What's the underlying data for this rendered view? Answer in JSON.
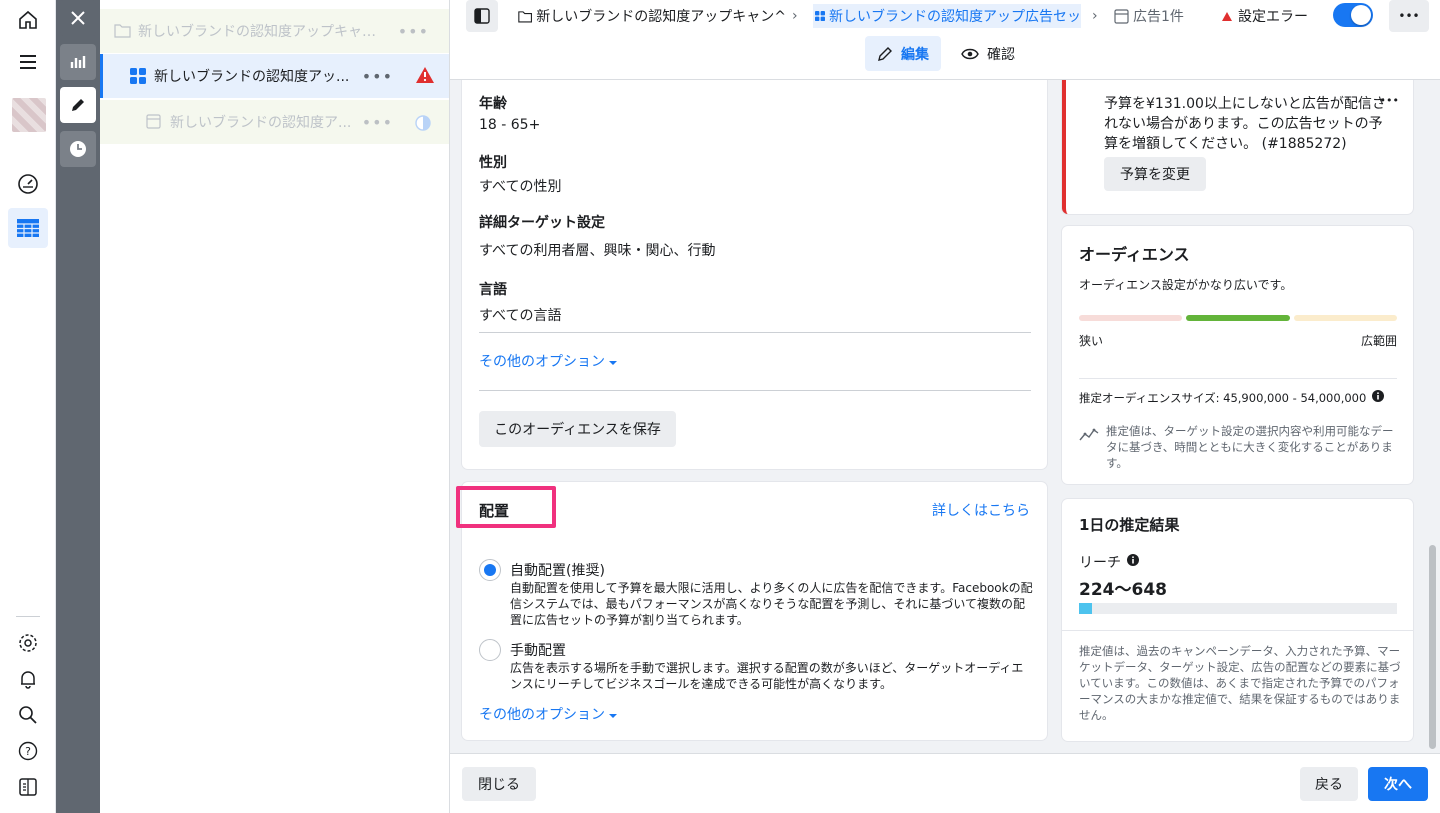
{
  "tree": {
    "campaign": "新しいブランドの認知度アップキャン...",
    "adset": "新しいブランドの認知度アッ...",
    "ad": "新しいブランドの認知度ア...",
    "dots": "•••"
  },
  "topbar": {
    "crumb_campaign": "新しいブランドの認知度アップキャン^",
    "crumb_adset": "新しいブランドの認知度アップ広告セッ",
    "crumb_ad": "広告1件",
    "error_label": "設定エラー",
    "tab_edit": "編集",
    "tab_review": "確認",
    "more": "•••"
  },
  "audience_section": {
    "age_label": "年齢",
    "age_value": "18 - 65+",
    "gender_label": "性別",
    "gender_value": "すべての性別",
    "detail_label": "詳細ターゲット設定",
    "detail_value": "すべての利用者層、興味・関心、行動",
    "lang_label": "言語",
    "lang_value": "すべての言語",
    "more_options": "その他のオプション",
    "save_audience": "このオーディエンスを保存"
  },
  "placement": {
    "title": "配置",
    "learn_more": "詳しくはこちら",
    "auto_label": "自動配置(推奨)",
    "auto_desc": "自動配置を使用して予算を最大限に活用し、より多くの人に広告を配信できます。Facebookの配信システムでは、最もパフォーマンスが高くなりそうな配置を予測し、それに基づいて複数の配置に広告セットの予算が割り当てられます。",
    "manual_label": "手動配置",
    "manual_desc": "広告を表示する場所を手動で選択します。選択する配置の数が多いほど、ターゲットオーディエンスにリーチしてビジネスゴールを達成できる可能性が高くなります。",
    "more_options": "その他のオプション"
  },
  "error_card": {
    "message": "予算を¥131.00以上にしないと広告が配信されない場合があります。この広告セットの予算を増額してください。 (#1885272)",
    "change_budget": "予算を変更",
    "dots": "•••"
  },
  "audience_card": {
    "title": "オーディエンス",
    "desc": "オーディエンス設定がかなり広いです。",
    "narrow": "狭い",
    "broad": "広範囲",
    "size_label": "推定オーディエンスサイズ: 45,900,000 - 54,000,000",
    "note": "推定値は、ターゲット設定の選択内容や利用可能なデータに基づき、時間とともに大きく変化することがあります。",
    "meter_level": "middle"
  },
  "results_card": {
    "title": "1日の推定結果",
    "reach_label": "リーチ",
    "reach_value": "224〜648",
    "reach_bar_fraction": 0.04,
    "note": "推定値は、過去のキャンペーンデータ、入力された予算、マーケットデータ、ターゲット設定、広告の配置などの要素に基づいています。この数値は、あくまで指定された予算でのパフォーマンスの大まかな推定値で、結果を保証するものではありません。"
  },
  "footer": {
    "close": "閉じる",
    "back": "戻る",
    "next": "次へ"
  },
  "colors": {
    "accent": "#1877f2",
    "error": "#e02f2f",
    "meter_green": "#63b43a",
    "highlight": "#f0317e"
  }
}
